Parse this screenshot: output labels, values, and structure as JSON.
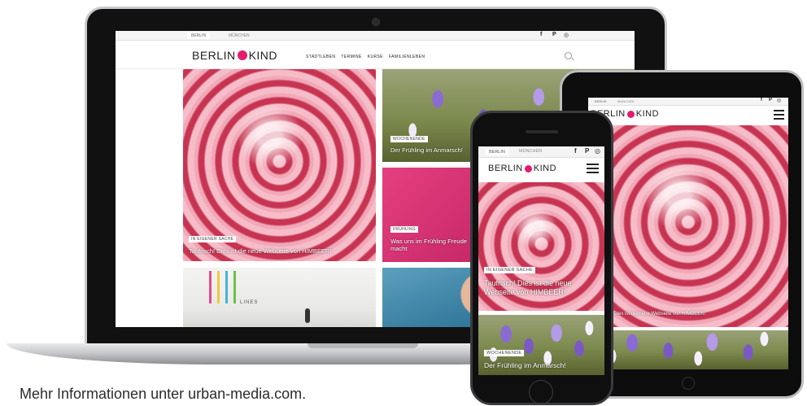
{
  "footer": {
    "info": "Mehr Informationen unter urban-media.com."
  },
  "site": {
    "city_tabs": [
      "BERLIN",
      "MÜNCHEN"
    ],
    "logo_left": "BERLIN",
    "logo_right": "KIND",
    "nav": [
      "STADTLEBEN",
      "TERMINE",
      "KURSE",
      "FAMILIENLEBEN"
    ],
    "social": [
      "f",
      "P",
      "◎"
    ]
  },
  "articles": {
    "lead": {
      "tag": "IN EIGENER SACHE",
      "title": "Taufrisch! Dies ist die neue Webseite von HIMBEER!"
    },
    "spring": {
      "tag": "WOCHENENDE",
      "title": "Der Frühling im Anmarsch!"
    },
    "fruehling": {
      "tag": "FRÜHLING",
      "title": "Was uns im Frühling Freude macht"
    },
    "gallery": {
      "sign": "LINES"
    }
  },
  "phone": {
    "lead_title": "Taufrisch! Dies ist die neue Webseite von HIMBEER!",
    "spring_title": "Der Frühling im Anmarsch!"
  },
  "colors": {
    "brand": "#e21d6e",
    "bezel": "#0d0d0d",
    "link": "#2c2c2c"
  }
}
